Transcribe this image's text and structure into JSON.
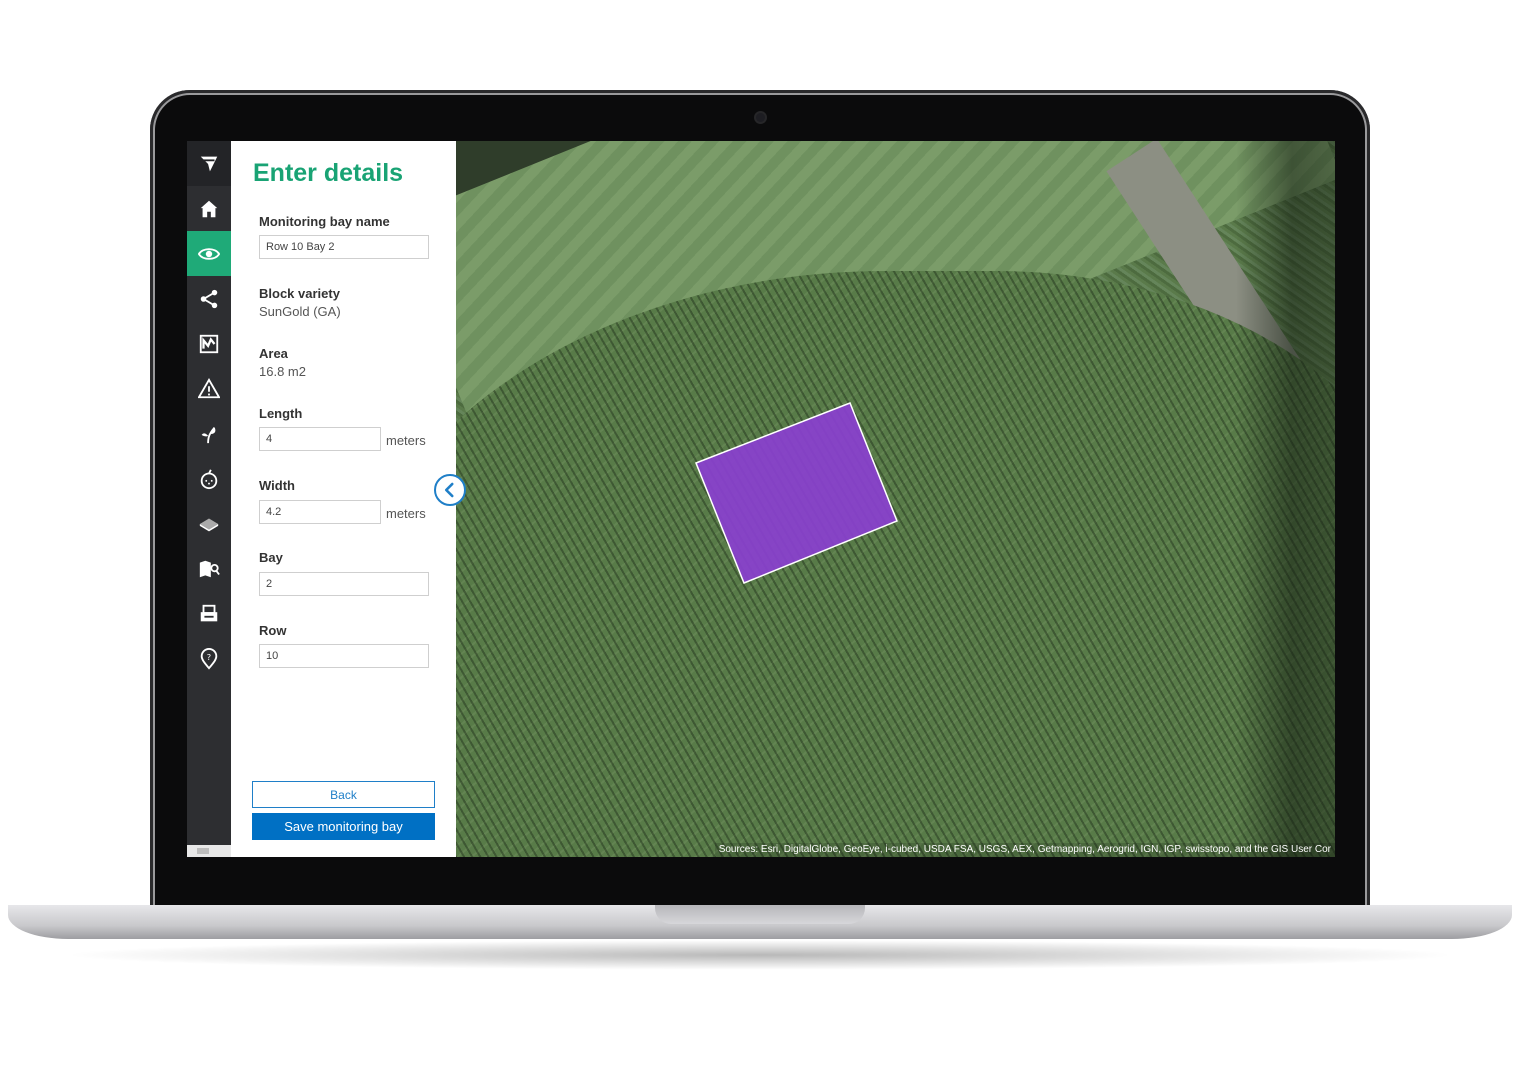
{
  "panel": {
    "title": "Enter details",
    "monitoring_bay_name": {
      "label": "Monitoring bay name",
      "value": "Row 10 Bay 2"
    },
    "block_variety": {
      "label": "Block variety",
      "value": "SunGold (GA)"
    },
    "area": {
      "label": "Area",
      "value": "16.8 m2"
    },
    "length": {
      "label": "Length",
      "value": "4",
      "unit": "meters"
    },
    "width": {
      "label": "Width",
      "value": "4.2",
      "unit": "meters"
    },
    "bay": {
      "label": "Bay",
      "value": "2"
    },
    "row": {
      "label": "Row",
      "value": "10"
    },
    "back_label": "Back",
    "save_label": "Save monitoring bay"
  },
  "sidebar": {
    "items": [
      {
        "icon": "logo-icon"
      },
      {
        "icon": "home-icon"
      },
      {
        "icon": "eye-icon",
        "active": true
      },
      {
        "icon": "share-icon"
      },
      {
        "icon": "chart-icon"
      },
      {
        "icon": "warning-icon"
      },
      {
        "icon": "sprout-icon"
      },
      {
        "icon": "fruit-icon"
      },
      {
        "icon": "layers-icon"
      },
      {
        "icon": "map-search-icon"
      },
      {
        "icon": "print-icon"
      },
      {
        "icon": "location-help-icon"
      }
    ]
  },
  "map": {
    "attribution": "Sources: Esri, DigitalGlobe, GeoEye, i-cubed, USDA FSA, USGS, AEX, Getmapping, Aerogrid, IGN, IGP, swisstopo, and the GIS User Cor",
    "bay_color": "#8a3fd0"
  },
  "colors": {
    "accent": "#1faa78",
    "primary": "#0070c4"
  }
}
